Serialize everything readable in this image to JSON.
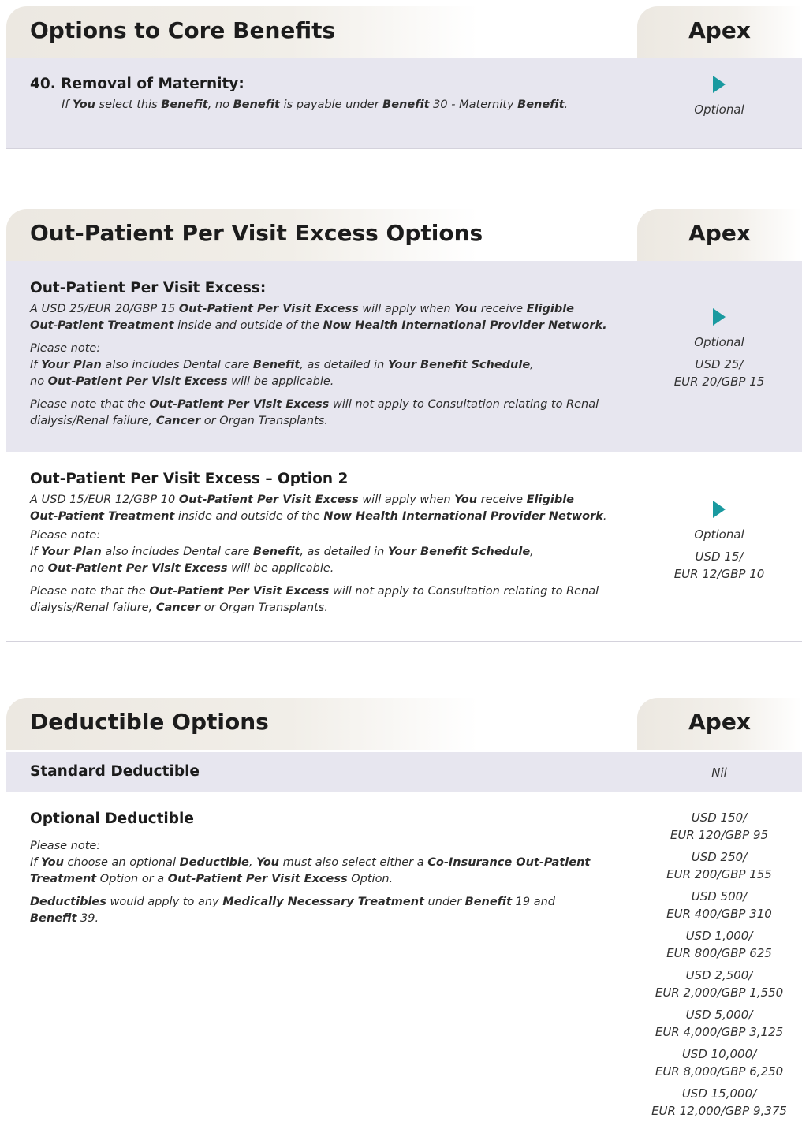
{
  "colors": {
    "accent_arrow": "#1a9aa0",
    "row_shade": "#e7e6ef",
    "header_bg": "#ece8e1"
  },
  "sec1": {
    "title": "Options to Core Benefits",
    "apex": "Apex",
    "item_number": "40.",
    "item_title": "Removal of Maternity:",
    "text": [
      {
        "t": "If "
      },
      {
        "t": "You",
        "b": true
      },
      {
        "t": " select this "
      },
      {
        "t": "Benefit",
        "b": true
      },
      {
        "t": ", no "
      },
      {
        "t": "Benefit",
        "b": true
      },
      {
        "t": " is payable under "
      },
      {
        "t": "Benefit",
        "b": true
      },
      {
        "t": " 30  - Maternity "
      },
      {
        "t": "Benefit",
        "b": true
      },
      {
        "t": "."
      }
    ],
    "value": "Optional"
  },
  "sec2": {
    "title": "Out-Patient Per Visit Excess Options",
    "apex": "Apex",
    "row1": {
      "title": "Out-Patient Per Visit Excess:",
      "para1": [
        {
          "t": "A USD 25/EUR 20/GBP 15 "
        },
        {
          "t": "Out-Patient Per Visit Excess",
          "b": true
        },
        {
          "t": " will apply when "
        },
        {
          "t": "You",
          "b": true
        },
        {
          "t": " receive "
        },
        {
          "t": "Eligible",
          "b": true
        },
        {
          "br": true
        },
        {
          "t": "Out",
          "b": true
        },
        {
          "t": "-"
        },
        {
          "t": "Patient Treatment",
          "b": true
        },
        {
          "t": " inside and outside of the "
        },
        {
          "t": "Now Health International Provider Network.",
          "b": true
        }
      ],
      "para2": [
        {
          "t": "Please note:"
        },
        {
          "br": true
        },
        {
          "t": "If "
        },
        {
          "t": "Your Plan",
          "b": true
        },
        {
          "t": " also includes Dental care "
        },
        {
          "t": "Benefit",
          "b": true
        },
        {
          "t": ", as detailed in "
        },
        {
          "t": "Your Benefit Schedule",
          "b": true
        },
        {
          "t": ","
        },
        {
          "br": true
        },
        {
          "t": "no "
        },
        {
          "t": "Out-Patient Per Visit Excess",
          "b": true
        },
        {
          "t": " will be applicable."
        }
      ],
      "para3": [
        {
          "t": "Please note that the "
        },
        {
          "t": "Out-Patient Per Visit Excess",
          "b": true
        },
        {
          "t": " will not apply to Consultation relating to Renal"
        },
        {
          "br": true
        },
        {
          "t": "dialysis/Renal failure, "
        },
        {
          "t": "Cancer",
          "b": true
        },
        {
          "t": " or Organ Transplants."
        }
      ],
      "value_label": "Optional",
      "value_line1": "USD 25/",
      "value_line2": "EUR 20/GBP 15"
    },
    "row2": {
      "title": "Out-Patient Per Visit Excess – Option 2",
      "para1": [
        {
          "t": "A USD 15/EUR 12/GBP 10 "
        },
        {
          "t": "Out-Patient Per Visit Excess",
          "b": true
        },
        {
          "t": " will apply when "
        },
        {
          "t": "You",
          "b": true
        },
        {
          "t": " receive "
        },
        {
          "t": "Eligible",
          "b": true
        },
        {
          "br": true
        },
        {
          "t": "Out-Patient Treatment",
          "b": true
        },
        {
          "t": " inside and outside of the "
        },
        {
          "t": "Now Health International Provider Network",
          "b": true
        },
        {
          "t": "."
        }
      ],
      "para2": [
        {
          "t": "Please note:"
        },
        {
          "br": true
        },
        {
          "t": "If "
        },
        {
          "t": "Your Plan",
          "b": true
        },
        {
          "t": " also includes Dental care "
        },
        {
          "t": "Benefit",
          "b": true
        },
        {
          "t": ", as detailed in "
        },
        {
          "t": "Your Benefit Schedule",
          "b": true
        },
        {
          "t": ","
        },
        {
          "br": true
        },
        {
          "t": "no "
        },
        {
          "t": "Out-Patient Per Visit Excess",
          "b": true
        },
        {
          "t": " will be applicable."
        }
      ],
      "para3": [
        {
          "t": "Please note that the "
        },
        {
          "t": "Out-Patient Per Visit Excess",
          "b": true
        },
        {
          "t": " will not apply to Consultation relating to Renal"
        },
        {
          "br": true
        },
        {
          "t": "dialysis/Renal failure, "
        },
        {
          "t": "Cancer",
          "b": true
        },
        {
          "t": " or Organ Transplants."
        }
      ],
      "value_label": "Optional",
      "value_line1": "USD 15/",
      "value_line2": "EUR 12/GBP 10"
    }
  },
  "sec3": {
    "title": "Deductible Options",
    "apex": "Apex",
    "standard_title": "Standard Deductible",
    "standard_value": "Nil",
    "optional_title": "Optional Deductible",
    "para1": [
      {
        "t": "Please note:"
      },
      {
        "br": true
      },
      {
        "t": "If "
      },
      {
        "t": "You",
        "b": true
      },
      {
        "t": " choose an optional "
      },
      {
        "t": "Deductible",
        "b": true
      },
      {
        "t": ", "
      },
      {
        "t": "You",
        "b": true
      },
      {
        "t": " must also select either a "
      },
      {
        "t": "Co-Insurance Out-Patient",
        "b": true
      },
      {
        "br": true
      },
      {
        "t": "Treatment",
        "b": true
      },
      {
        "t": " Option or a "
      },
      {
        "t": "Out-Patient Per Visit Excess",
        "b": true
      },
      {
        "t": " Option."
      }
    ],
    "para2": [
      {
        "t": "Deductibles",
        "b": true
      },
      {
        "t": " would apply to any "
      },
      {
        "t": "Medically Necessary Treatment",
        "b": true
      },
      {
        "t": " under "
      },
      {
        "t": "Benefit",
        "b": true
      },
      {
        "t": " 19 and"
      },
      {
        "br": true
      },
      {
        "t": "Benefit",
        "b": true
      },
      {
        "t": " 39."
      }
    ],
    "values": [
      {
        "l1": "USD 150/",
        "l2": "EUR 120/GBP 95"
      },
      {
        "l1": "USD 250/",
        "l2": "EUR 200/GBP 155"
      },
      {
        "l1": "USD 500/",
        "l2": "EUR 400/GBP 310"
      },
      {
        "l1": "USD 1,000/",
        "l2": "EUR 800/GBP 625"
      },
      {
        "l1": "USD 2,500/",
        "l2": "EUR 2,000/GBP 1,550"
      },
      {
        "l1": "USD 5,000/",
        "l2": "EUR 4,000/GBP 3,125"
      },
      {
        "l1": "USD 10,000/",
        "l2": "EUR 8,000/GBP 6,250"
      },
      {
        "l1": "USD 15,000/",
        "l2": "EUR 12,000/GBP 9,375"
      }
    ]
  }
}
